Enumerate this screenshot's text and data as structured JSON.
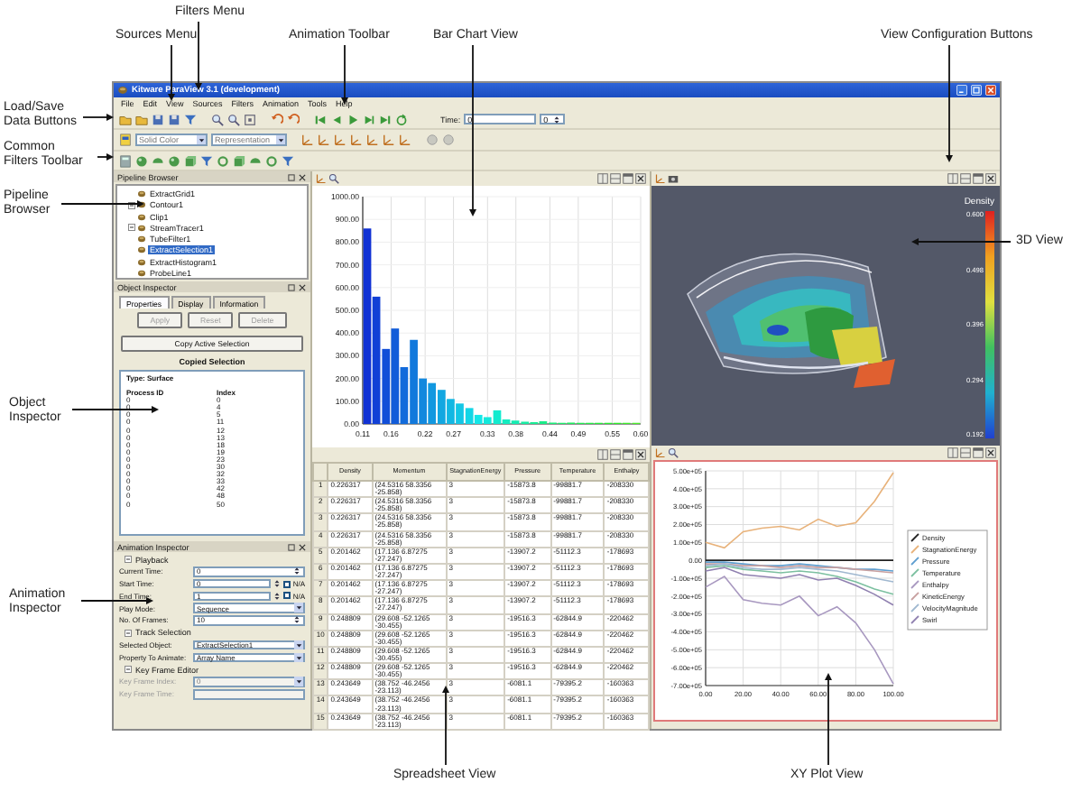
{
  "callouts": [
    {
      "lines": [
        "Sources Menu"
      ]
    },
    {
      "lines": [
        "Filters Menu"
      ]
    },
    {
      "lines": [
        "Animation Toolbar"
      ]
    },
    {
      "lines": [
        "Bar Chart View"
      ]
    },
    {
      "lines": [
        "View Configuration Buttons"
      ]
    },
    {
      "lines": [
        "Load/Save",
        "Data Buttons"
      ]
    },
    {
      "lines": [
        "Common",
        "Filters Toolbar"
      ]
    },
    {
      "lines": [
        "Pipeline",
        "Browser"
      ]
    },
    {
      "lines": [
        "3D View"
      ]
    },
    {
      "lines": [
        "Object",
        "Inspector"
      ]
    },
    {
      "lines": [
        "Animation",
        "Inspector"
      ]
    },
    {
      "lines": [
        "Spreadsheet View"
      ]
    },
    {
      "lines": [
        "XY Plot View"
      ]
    }
  ],
  "window": {
    "title": "Kitware ParaView 3.1 (development)"
  },
  "menu": [
    "File",
    "Edit",
    "View",
    "Sources",
    "Filters",
    "Animation",
    "Tools",
    "Help"
  ],
  "time": {
    "label": "Time:",
    "value": "0",
    "index": "0"
  },
  "display_toolbar": {
    "color_by": "Solid Color",
    "representation": "Representation"
  },
  "pipeline_browser": {
    "title": "Pipeline Browser",
    "items": [
      {
        "label": "ExtractGrid1",
        "expandable": false,
        "selected": false
      },
      {
        "label": "Contour1",
        "expandable": true,
        "selected": false
      },
      {
        "label": "Clip1",
        "expandable": false,
        "selected": false
      },
      {
        "label": "StreamTracer1",
        "expandable": true,
        "selected": false
      },
      {
        "label": "TubeFilter1",
        "expandable": false,
        "selected": false
      },
      {
        "label": "ExtractSelection1",
        "expandable": false,
        "selected": true
      },
      {
        "label": "ExtractHistogram1",
        "expandable": false,
        "selected": false
      },
      {
        "label": "ProbeLine1",
        "expandable": false,
        "selected": false
      }
    ]
  },
  "object_inspector": {
    "title": "Object Inspector",
    "tabs": [
      {
        "label": "Properties",
        "selected": true
      },
      {
        "label": "Display",
        "selected": false
      },
      {
        "label": "Information",
        "selected": false
      }
    ],
    "buttons": [
      {
        "label": "Apply",
        "disabled": true
      },
      {
        "label": "Reset",
        "disabled": true
      },
      {
        "label": "Delete",
        "disabled": true
      }
    ],
    "copy_button": "Copy Active Selection",
    "section_title": "Copied Selection",
    "type_label": "Type: Surface",
    "columns": [
      "Process ID",
      "Index"
    ],
    "rows": [
      [
        "0",
        "0"
      ],
      [
        "0",
        "4"
      ],
      [
        "0",
        "5"
      ],
      [
        "0",
        "11"
      ],
      [
        "0",
        "12"
      ],
      [
        "0",
        "13"
      ],
      [
        "0",
        "18"
      ],
      [
        "0",
        "19"
      ],
      [
        "0",
        "23"
      ],
      [
        "0",
        "30"
      ],
      [
        "0",
        "32"
      ],
      [
        "0",
        "33"
      ],
      [
        "0",
        "42"
      ],
      [
        "0",
        "48"
      ],
      [
        "0",
        "50"
      ]
    ]
  },
  "animation_inspector": {
    "title": "Animation Inspector",
    "sections": [
      {
        "label": "Playback",
        "expanded": true,
        "fields": [
          {
            "label": "Current Time:",
            "value": "0",
            "kind": "spin",
            "disabled": false
          },
          {
            "label": "Start Time:",
            "value": "0",
            "kind": "na",
            "na_label": "N/A",
            "na_checked": false,
            "disabled": false
          },
          {
            "label": "End Time:",
            "value": "1",
            "kind": "na",
            "na_label": "N/A",
            "na_checked": false,
            "disabled": false
          },
          {
            "label": "Play Mode:",
            "value": "Sequence",
            "kind": "combo",
            "disabled": false
          },
          {
            "label": "No. Of Frames:",
            "value": "10",
            "kind": "spin",
            "disabled": false
          }
        ]
      },
      {
        "label": "Track Selection",
        "expanded": true,
        "fields": [
          {
            "label": "Selected Object:",
            "value": "ExtractSelection1",
            "kind": "combo",
            "disabled": false
          },
          {
            "label": "Property To Animate:",
            "value": "Array Name",
            "kind": "combo",
            "disabled": false
          }
        ]
      },
      {
        "label": "Key Frame Editor",
        "expanded": true,
        "fields": [
          {
            "label": "Key Frame Index:",
            "value": "0",
            "kind": "combo",
            "disabled": true
          },
          {
            "label": "Key Frame Time:",
            "kind": "text",
            "disabled": true
          }
        ]
      }
    ]
  },
  "bar_chart": {
    "chart_data": {
      "type": "bar",
      "x": [
        0.118,
        0.134,
        0.151,
        0.167,
        0.183,
        0.2,
        0.216,
        0.232,
        0.249,
        0.265,
        0.281,
        0.298,
        0.314,
        0.33,
        0.347,
        0.363,
        0.379,
        0.396,
        0.412,
        0.428,
        0.445,
        0.461,
        0.477,
        0.494,
        0.51,
        0.526,
        0.543,
        0.559,
        0.575,
        0.592
      ],
      "values": [
        860,
        560,
        330,
        420,
        250,
        370,
        200,
        180,
        150,
        110,
        90,
        70,
        40,
        30,
        60,
        20,
        15,
        10,
        8,
        12,
        6,
        5,
        6,
        5,
        5,
        5,
        5,
        5,
        5,
        5
      ],
      "xlim": [
        0.11,
        0.6
      ],
      "ylim": [
        0,
        1000
      ],
      "grid": true,
      "xticks": [
        {
          "value": 0.11,
          "label": "0.11"
        },
        {
          "value": 0.16,
          "label": "0.16"
        },
        {
          "value": 0.22,
          "label": "0.22"
        },
        {
          "value": 0.27,
          "label": "0.27"
        },
        {
          "value": 0.33,
          "label": "0.33"
        },
        {
          "value": 0.38,
          "label": "0.38"
        },
        {
          "value": 0.44,
          "label": "0.44"
        },
        {
          "value": 0.49,
          "label": "0.49"
        },
        {
          "value": 0.55,
          "label": "0.55"
        },
        {
          "value": 0.6,
          "label": "0.60"
        }
      ],
      "yticks": [
        {
          "value": 0,
          "label": "0.00"
        },
        {
          "value": 100,
          "label": "100.00"
        },
        {
          "value": 200,
          "label": "200.00"
        },
        {
          "value": 300,
          "label": "300.00"
        },
        {
          "value": 400,
          "label": "400.00"
        },
        {
          "value": 500,
          "label": "500.00"
        },
        {
          "value": 600,
          "label": "600.00"
        },
        {
          "value": 700,
          "label": "700.00"
        },
        {
          "value": 800,
          "label": "800.00"
        },
        {
          "value": 900,
          "label": "900.00"
        },
        {
          "value": 1000,
          "label": "1000.00"
        }
      ]
    }
  },
  "view_3d": {
    "legend_title": "Density",
    "legend_labels": [
      "0.600",
      "0.498",
      "0.396",
      "0.294",
      "0.192"
    ]
  },
  "spreadsheet": {
    "columns": [
      "Density",
      "Momentum",
      "StagnationEnergy",
      "Pressure",
      "Temperature",
      "Enthalpy"
    ],
    "rows": [
      {
        "index": "1",
        "cells": [
          "0.226317",
          "(24.5316 58.3356 -25.858)",
          "3",
          "-15873.8",
          "-99881.7",
          "-208330"
        ]
      },
      {
        "index": "2",
        "cells": [
          "0.226317",
          "(24.5316 58.3356 -25.858)",
          "3",
          "-15873.8",
          "-99881.7",
          "-208330"
        ]
      },
      {
        "index": "3",
        "cells": [
          "0.226317",
          "(24.5316 58.3356 -25.858)",
          "3",
          "-15873.8",
          "-99881.7",
          "-208330"
        ]
      },
      {
        "index": "4",
        "cells": [
          "0.226317",
          "(24.5316 58.3356 -25.858)",
          "3",
          "-15873.8",
          "-99881.7",
          "-208330"
        ]
      },
      {
        "index": "5",
        "cells": [
          "0.201462",
          "(17.136 6.87275 -27.247)",
          "3",
          "-13907.2",
          "-51112.3",
          "-178693"
        ]
      },
      {
        "index": "6",
        "cells": [
          "0.201462",
          "(17.136 6.87275 -27.247)",
          "3",
          "-13907.2",
          "-51112.3",
          "-178693"
        ]
      },
      {
        "index": "7",
        "cells": [
          "0.201462",
          "(17.136 6.87275 -27.247)",
          "3",
          "-13907.2",
          "-51112.3",
          "-178693"
        ]
      },
      {
        "index": "8",
        "cells": [
          "0.201462",
          "(17.136 6.87275 -27.247)",
          "3",
          "-13907.2",
          "-51112.3",
          "-178693"
        ]
      },
      {
        "index": "9",
        "cells": [
          "0.248809",
          "(29.608 -52.1265 -30.455)",
          "3",
          "-19516.3",
          "-62844.9",
          "-220462"
        ]
      },
      {
        "index": "10",
        "cells": [
          "0.248809",
          "(29.608 -52.1265 -30.455)",
          "3",
          "-19516.3",
          "-62844.9",
          "-220462"
        ]
      },
      {
        "index": "11",
        "cells": [
          "0.248809",
          "(29.608 -52.1265 -30.455)",
          "3",
          "-19516.3",
          "-62844.9",
          "-220462"
        ]
      },
      {
        "index": "12",
        "cells": [
          "0.248809",
          "(29.608 -52.1265 -30.455)",
          "3",
          "-19516.3",
          "-62844.9",
          "-220462"
        ]
      },
      {
        "index": "13",
        "cells": [
          "0.243649",
          "(38.752 -46.2456 -23.113)",
          "3",
          "-6081.1",
          "-79395.2",
          "-160363"
        ]
      },
      {
        "index": "14",
        "cells": [
          "0.243649",
          "(38.752 -46.2456 -23.113)",
          "3",
          "-6081.1",
          "-79395.2",
          "-160363"
        ]
      },
      {
        "index": "15",
        "cells": [
          "0.243649",
          "(38.752 -46.2456 -23.113)",
          "3",
          "-6081.1",
          "-79395.2",
          "-160363"
        ]
      }
    ]
  },
  "xy_plot": {
    "chart_data": {
      "type": "line",
      "x": [
        0,
        10,
        20,
        30,
        40,
        50,
        60,
        70,
        80,
        90,
        100
      ],
      "series": [
        {
          "name": "Density",
          "color": "#222222",
          "values": [
            0,
            0,
            0,
            0,
            0,
            0,
            0,
            0,
            0,
            0,
            0
          ]
        },
        {
          "name": "StagnationEnergy",
          "color": "#e8b27a",
          "values": [
            100000,
            70000,
            160000,
            180000,
            190000,
            170000,
            230000,
            190000,
            210000,
            330000,
            490000
          ]
        },
        {
          "name": "Pressure",
          "color": "#5f9fd0",
          "values": [
            -10000,
            -10000,
            -20000,
            -30000,
            -30000,
            -20000,
            -30000,
            -40000,
            -50000,
            -50000,
            -60000
          ]
        },
        {
          "name": "Temperature",
          "color": "#7cc0a0",
          "values": [
            -40000,
            -30000,
            -50000,
            -60000,
            -70000,
            -60000,
            -70000,
            -90000,
            -120000,
            -160000,
            -190000
          ]
        },
        {
          "name": "Enthalpy",
          "color": "#a898c0",
          "values": [
            -150000,
            -90000,
            -220000,
            -240000,
            -250000,
            -200000,
            -310000,
            -260000,
            -350000,
            -500000,
            -690000
          ]
        },
        {
          "name": "KineticEnergy",
          "color": "#c8a0a0",
          "values": [
            -20000,
            -20000,
            -30000,
            -30000,
            -40000,
            -30000,
            -40000,
            -40000,
            -50000,
            -60000,
            -70000
          ]
        },
        {
          "name": "VelocityMagnitude",
          "color": "#a0b8d0",
          "values": [
            -30000,
            -20000,
            -40000,
            -50000,
            -50000,
            -40000,
            -50000,
            -60000,
            -80000,
            -100000,
            -120000
          ]
        },
        {
          "name": "Swirl",
          "color": "#9080b0",
          "values": [
            -60000,
            -40000,
            -80000,
            -90000,
            -100000,
            -80000,
            -110000,
            -100000,
            -140000,
            -190000,
            -250000
          ]
        }
      ],
      "xlim": [
        0,
        100
      ],
      "ylim": [
        -700000,
        500000
      ],
      "grid": true,
      "legend": true,
      "xticks": [
        {
          "value": 0,
          "label": "0.00"
        },
        {
          "value": 20,
          "label": "20.00"
        },
        {
          "value": 40,
          "label": "40.00"
        },
        {
          "value": 60,
          "label": "60.00"
        },
        {
          "value": 80,
          "label": "80.00"
        },
        {
          "value": 100,
          "label": "100.00"
        }
      ],
      "yticks": [
        {
          "value": 500000,
          "label": "5.00e+05"
        },
        {
          "value": 400000,
          "label": "4.00e+05"
        },
        {
          "value": 300000,
          "label": "3.00e+05"
        },
        {
          "value": 200000,
          "label": "2.00e+05"
        },
        {
          "value": 100000,
          "label": "1.00e+05"
        },
        {
          "value": 0,
          "label": "0.00"
        },
        {
          "value": -100000,
          "label": "-1.00e+05"
        },
        {
          "value": -200000,
          "label": "-2.00e+05"
        },
        {
          "value": -300000,
          "label": "-3.00e+05"
        },
        {
          "value": -400000,
          "label": "-4.00e+05"
        },
        {
          "value": -500000,
          "label": "-5.00e+05"
        },
        {
          "value": -600000,
          "label": "-6.00e+05"
        },
        {
          "value": -700000,
          "label": "-7.00e+05"
        }
      ]
    },
    "active": true
  }
}
